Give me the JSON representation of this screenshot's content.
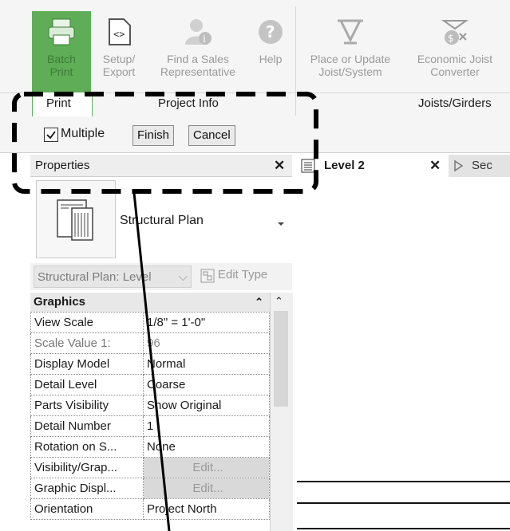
{
  "ribbon": {
    "buttons": [
      {
        "label1": "Batch",
        "label2": "Print",
        "icon": "printer-icon"
      },
      {
        "label1": "Setup/",
        "label2": "Export",
        "icon": "export-icon"
      },
      {
        "label1": "Find a Sales",
        "label2": "Representative",
        "icon": "sales-rep-icon"
      },
      {
        "label1": "Help",
        "label2": "",
        "icon": "help-icon"
      },
      {
        "label1": "Place or Update",
        "label2": "Joist/System",
        "icon": "joist-icon"
      },
      {
        "label1": "Economic Joist",
        "label2": "Converter",
        "icon": "joist-converter-icon"
      }
    ],
    "panels": [
      "Print",
      "Project Info",
      "Joists/Girders"
    ]
  },
  "options_bar": {
    "multiple_label": "Multiple",
    "multiple_checked": true,
    "finish_label": "Finish",
    "cancel_label": "Cancel"
  },
  "properties": {
    "title": "Properties",
    "close_glyph": "✕",
    "type_name": "Structural Plan",
    "selector_value": "Structural Plan: Level",
    "edit_type_label": "Edit Type",
    "group_name": "Graphics",
    "rows": [
      {
        "key": "View Scale",
        "value": "1/8\" = 1'-0\""
      },
      {
        "key": "Scale Value    1:",
        "value": "96"
      },
      {
        "key": "Display Model",
        "value": "Normal"
      },
      {
        "key": "Detail Level",
        "value": "Coarse"
      },
      {
        "key": "Parts Visibility",
        "value": "Show Original"
      },
      {
        "key": "Detail Number",
        "value": "1"
      },
      {
        "key": "Rotation on S...",
        "value": "None"
      },
      {
        "key": "Visibility/Grap...",
        "value": "Edit..."
      },
      {
        "key": "Graphic Displ...",
        "value": "Edit..."
      },
      {
        "key": "Orientation",
        "value": "Project North"
      }
    ]
  },
  "view_tabs": [
    {
      "label": "Level 2",
      "close": "✕"
    },
    {
      "label": "Sec"
    }
  ],
  "colors": {
    "accent_green": "#5fae57",
    "annotation": "#000000"
  }
}
